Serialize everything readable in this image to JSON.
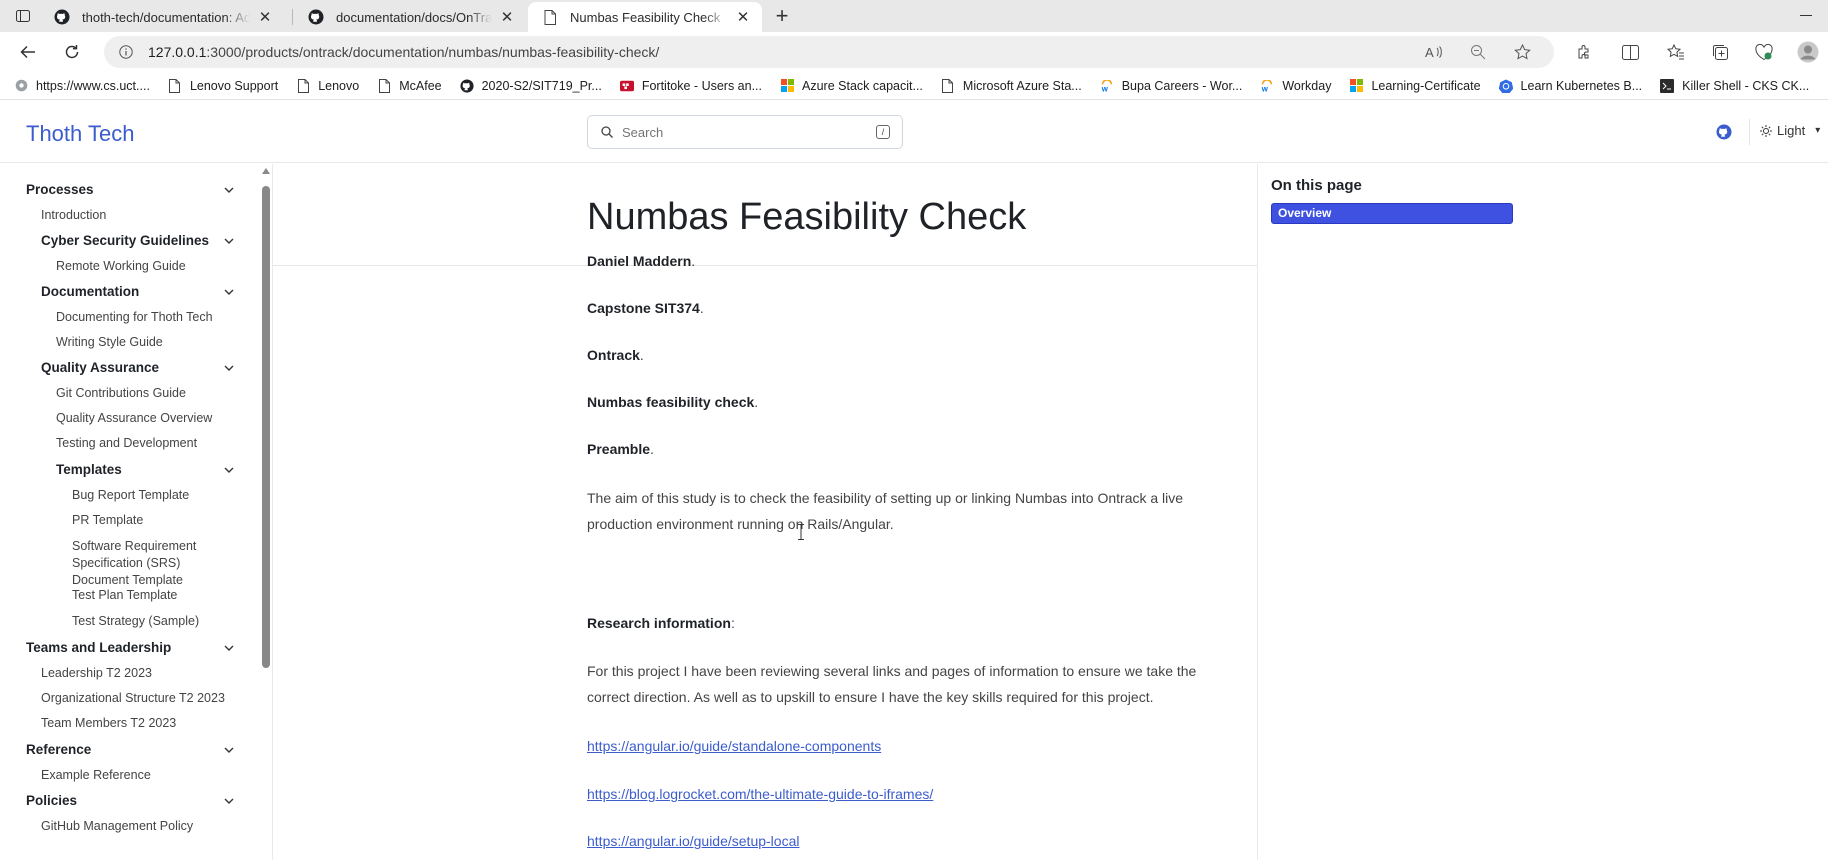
{
  "browser": {
    "tabs": [
      {
        "title": "thoth-tech/documentation: Add",
        "icon": "github-icon",
        "active": false
      },
      {
        "title": "documentation/docs/OnTrack/N",
        "icon": "github-icon",
        "active": false
      },
      {
        "title": "Numbas Feasibility Check",
        "icon": "page-icon",
        "active": true
      }
    ],
    "url_host": "127.0.0.1",
    "url_rest": ":3000/products/ontrack/documentation/numbas/numbas-feasibility-check/",
    "bookmarks": [
      {
        "label": "https://www.cs.uct....",
        "icon": "globe-icon"
      },
      {
        "label": "Lenovo Support",
        "icon": "page-icon"
      },
      {
        "label": "Lenovo",
        "icon": "page-icon"
      },
      {
        "label": "McAfee",
        "icon": "page-icon"
      },
      {
        "label": "2020-S2/SIT719_Pr...",
        "icon": "github-icon"
      },
      {
        "label": "Fortitoke - Users an...",
        "icon": "fortitoke-icon"
      },
      {
        "label": "Azure Stack capacit...",
        "icon": "microsoft-icon"
      },
      {
        "label": "Microsoft Azure Sta...",
        "icon": "page-icon"
      },
      {
        "label": "Bupa Careers - Wor...",
        "icon": "workday-icon"
      },
      {
        "label": "Workday",
        "icon": "workday-icon"
      },
      {
        "label": "Learning-Certificate",
        "icon": "microsoft-icon"
      },
      {
        "label": "Learn Kubernetes B...",
        "icon": "kubernetes-icon"
      },
      {
        "label": "Killer Shell - CKS CK...",
        "icon": "terminal-icon"
      }
    ]
  },
  "site": {
    "title": "Thoth Tech",
    "search_placeholder": "Search",
    "search_shortcut": "/",
    "theme_label": "Light"
  },
  "sidebar": {
    "items": [
      {
        "label": "Processes",
        "level": "group",
        "chevron": true
      },
      {
        "label": "Introduction",
        "level": "item1",
        "chevron": false
      },
      {
        "label": "Cyber Security Guidelines",
        "level": "sub",
        "chevron": true
      },
      {
        "label": "Remote Working Guide",
        "level": "item2",
        "chevron": false
      },
      {
        "label": "Documentation",
        "level": "sub",
        "chevron": true
      },
      {
        "label": "Documenting for Thoth Tech",
        "level": "item2",
        "chevron": false
      },
      {
        "label": "Writing Style Guide",
        "level": "item2",
        "chevron": false
      },
      {
        "label": "Quality Assurance",
        "level": "sub",
        "chevron": true
      },
      {
        "label": "Git Contributions Guide",
        "level": "item2",
        "chevron": false
      },
      {
        "label": "Quality Assurance Overview",
        "level": "item2",
        "chevron": false
      },
      {
        "label": "Testing and Development",
        "level": "item2",
        "chevron": false
      },
      {
        "label": "Templates",
        "level": "sub2",
        "chevron": true
      },
      {
        "label": "Bug Report Template",
        "level": "item3",
        "chevron": false
      },
      {
        "label": "PR Template",
        "level": "item3",
        "chevron": false
      },
      {
        "label": "Software Requirement Specification (SRS) Document Template",
        "level": "item3",
        "chevron": false
      },
      {
        "label": "Test Plan Template",
        "level": "item3",
        "chevron": false
      },
      {
        "label": "Test Strategy (Sample)",
        "level": "item3",
        "chevron": false
      },
      {
        "label": "Teams and Leadership",
        "level": "group",
        "chevron": true
      },
      {
        "label": "Leadership T2 2023",
        "level": "item1",
        "chevron": false
      },
      {
        "label": "Organizational Structure T2 2023",
        "level": "item1",
        "chevron": false
      },
      {
        "label": "Team Members T2 2023",
        "level": "item1",
        "chevron": false
      },
      {
        "label": "Reference",
        "level": "group",
        "chevron": true
      },
      {
        "label": "Example Reference",
        "level": "item1",
        "chevron": false
      },
      {
        "label": "Policies",
        "level": "group",
        "chevron": true
      },
      {
        "label": "GitHub Management Policy",
        "level": "item1",
        "chevron": false
      }
    ]
  },
  "main": {
    "title": "Numbas Feasibility Check",
    "paragraphs": [
      {
        "type": "bold",
        "text": "Daniel Maddern",
        "suffix": "."
      },
      {
        "type": "bold",
        "text": "Capstone SIT374",
        "suffix": "."
      },
      {
        "type": "bold",
        "text": "Ontrack",
        "suffix": "."
      },
      {
        "type": "bold",
        "text": "Numbas feasibility check",
        "suffix": "."
      },
      {
        "type": "bold",
        "text": "Preamble",
        "suffix": "."
      },
      {
        "type": "text",
        "text": "The aim of this study is to check the feasibility of setting up or linking Numbas into Ontrack a live production environment running on Rails/Angular."
      },
      {
        "type": "bold",
        "text": "Research information",
        "suffix": ":"
      },
      {
        "type": "text",
        "text": "For this project I have been reviewing several links and pages of information to ensure we take the correct direction. As well as to upskill to ensure I have the key skills required for this project."
      },
      {
        "type": "link",
        "text": "https://angular.io/guide/standalone-components"
      },
      {
        "type": "link",
        "text": "https://blog.logrocket.com/the-ultimate-guide-to-iframes/"
      },
      {
        "type": "link",
        "text": "https://angular.io/guide/setup-local"
      }
    ]
  },
  "toc": {
    "heading": "On this page",
    "items": [
      "Overview"
    ]
  },
  "colors": {
    "brand": "#3b5ccc",
    "toc_active": "#3f51e0",
    "link": "#3b5ccc"
  }
}
